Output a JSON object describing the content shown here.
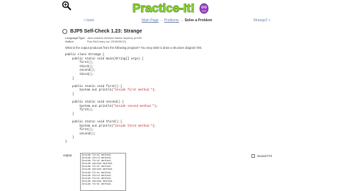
{
  "toolbar": {
    "zoom_icon": "magnifier-icon"
  },
  "logo": {
    "text": "Practice-It!",
    "accent": "#8bd12f",
    "mascot_color": "#9a3fc7"
  },
  "nav": {
    "back": "< back",
    "crumbs": {
      "main": "Main Page",
      "sep1": "→",
      "problems": "Problems",
      "sep2": "→",
      "current": "Solve a Problem"
    },
    "forward": "Strange2 >"
  },
  "problem": {
    "title": "BJP5 Self-Check 1.23: Strange",
    "meta": [
      {
        "key": "Language/Type:",
        "value": "Java classes method basics mystery println"
      },
      {
        "key": "Author:",
        "value": "Roy McCreary (on 2018/06/10)"
      }
    ],
    "question": "What is the output produced from the following program? You may wish to draw a structure diagram first."
  },
  "code_lines": [
    [
      {
        "t": "public class Strange {"
      }
    ],
    [
      {
        "t": "    public static void main(String[] args) {"
      }
    ],
    [
      {
        "t": "        first();"
      }
    ],
    [
      {
        "t": "        third();"
      }
    ],
    [
      {
        "t": "        second();"
      }
    ],
    [
      {
        "t": "        third();"
      }
    ],
    [
      {
        "t": "    }"
      }
    ],
    [
      {
        "t": ""
      }
    ],
    [
      {
        "t": "    public static void first() {"
      }
    ],
    [
      {
        "t": "        System.out.println("
      },
      {
        "t": "\"Inside first method.\"",
        "s": 1
      },
      {
        "t": ");"
      }
    ],
    [
      {
        "t": "    }"
      }
    ],
    [
      {
        "t": ""
      }
    ],
    [
      {
        "t": "    public static void second() {"
      }
    ],
    [
      {
        "t": "        System.out.println("
      },
      {
        "t": "\"Inside second method.\"",
        "s": 1
      },
      {
        "t": ");"
      }
    ],
    [
      {
        "t": "        first();"
      }
    ],
    [
      {
        "t": "    }"
      }
    ],
    [
      {
        "t": ""
      }
    ],
    [
      {
        "t": "    public static void third() {"
      }
    ],
    [
      {
        "t": "        System.out.println("
      },
      {
        "t": "\"Inside third method.\"",
        "s": 1
      },
      {
        "t": ");"
      }
    ],
    [
      {
        "t": "        first();"
      }
    ],
    [
      {
        "t": "        second();"
      }
    ],
    [
      {
        "t": "    }"
      }
    ],
    [
      {
        "t": "}"
      }
    ]
  ],
  "answer": {
    "label": "output",
    "lines": [
      "Inside first method.",
      "Inside third method.",
      "Inside first method.",
      "Inside second method.",
      "Inside first method.",
      "Inside second method.",
      "Inside first method.",
      "Inside third method.",
      "Inside first method.",
      "Inside second method.",
      "Inside first method."
    ]
  },
  "sound": {
    "label": "Sound F/X",
    "checked": false
  }
}
